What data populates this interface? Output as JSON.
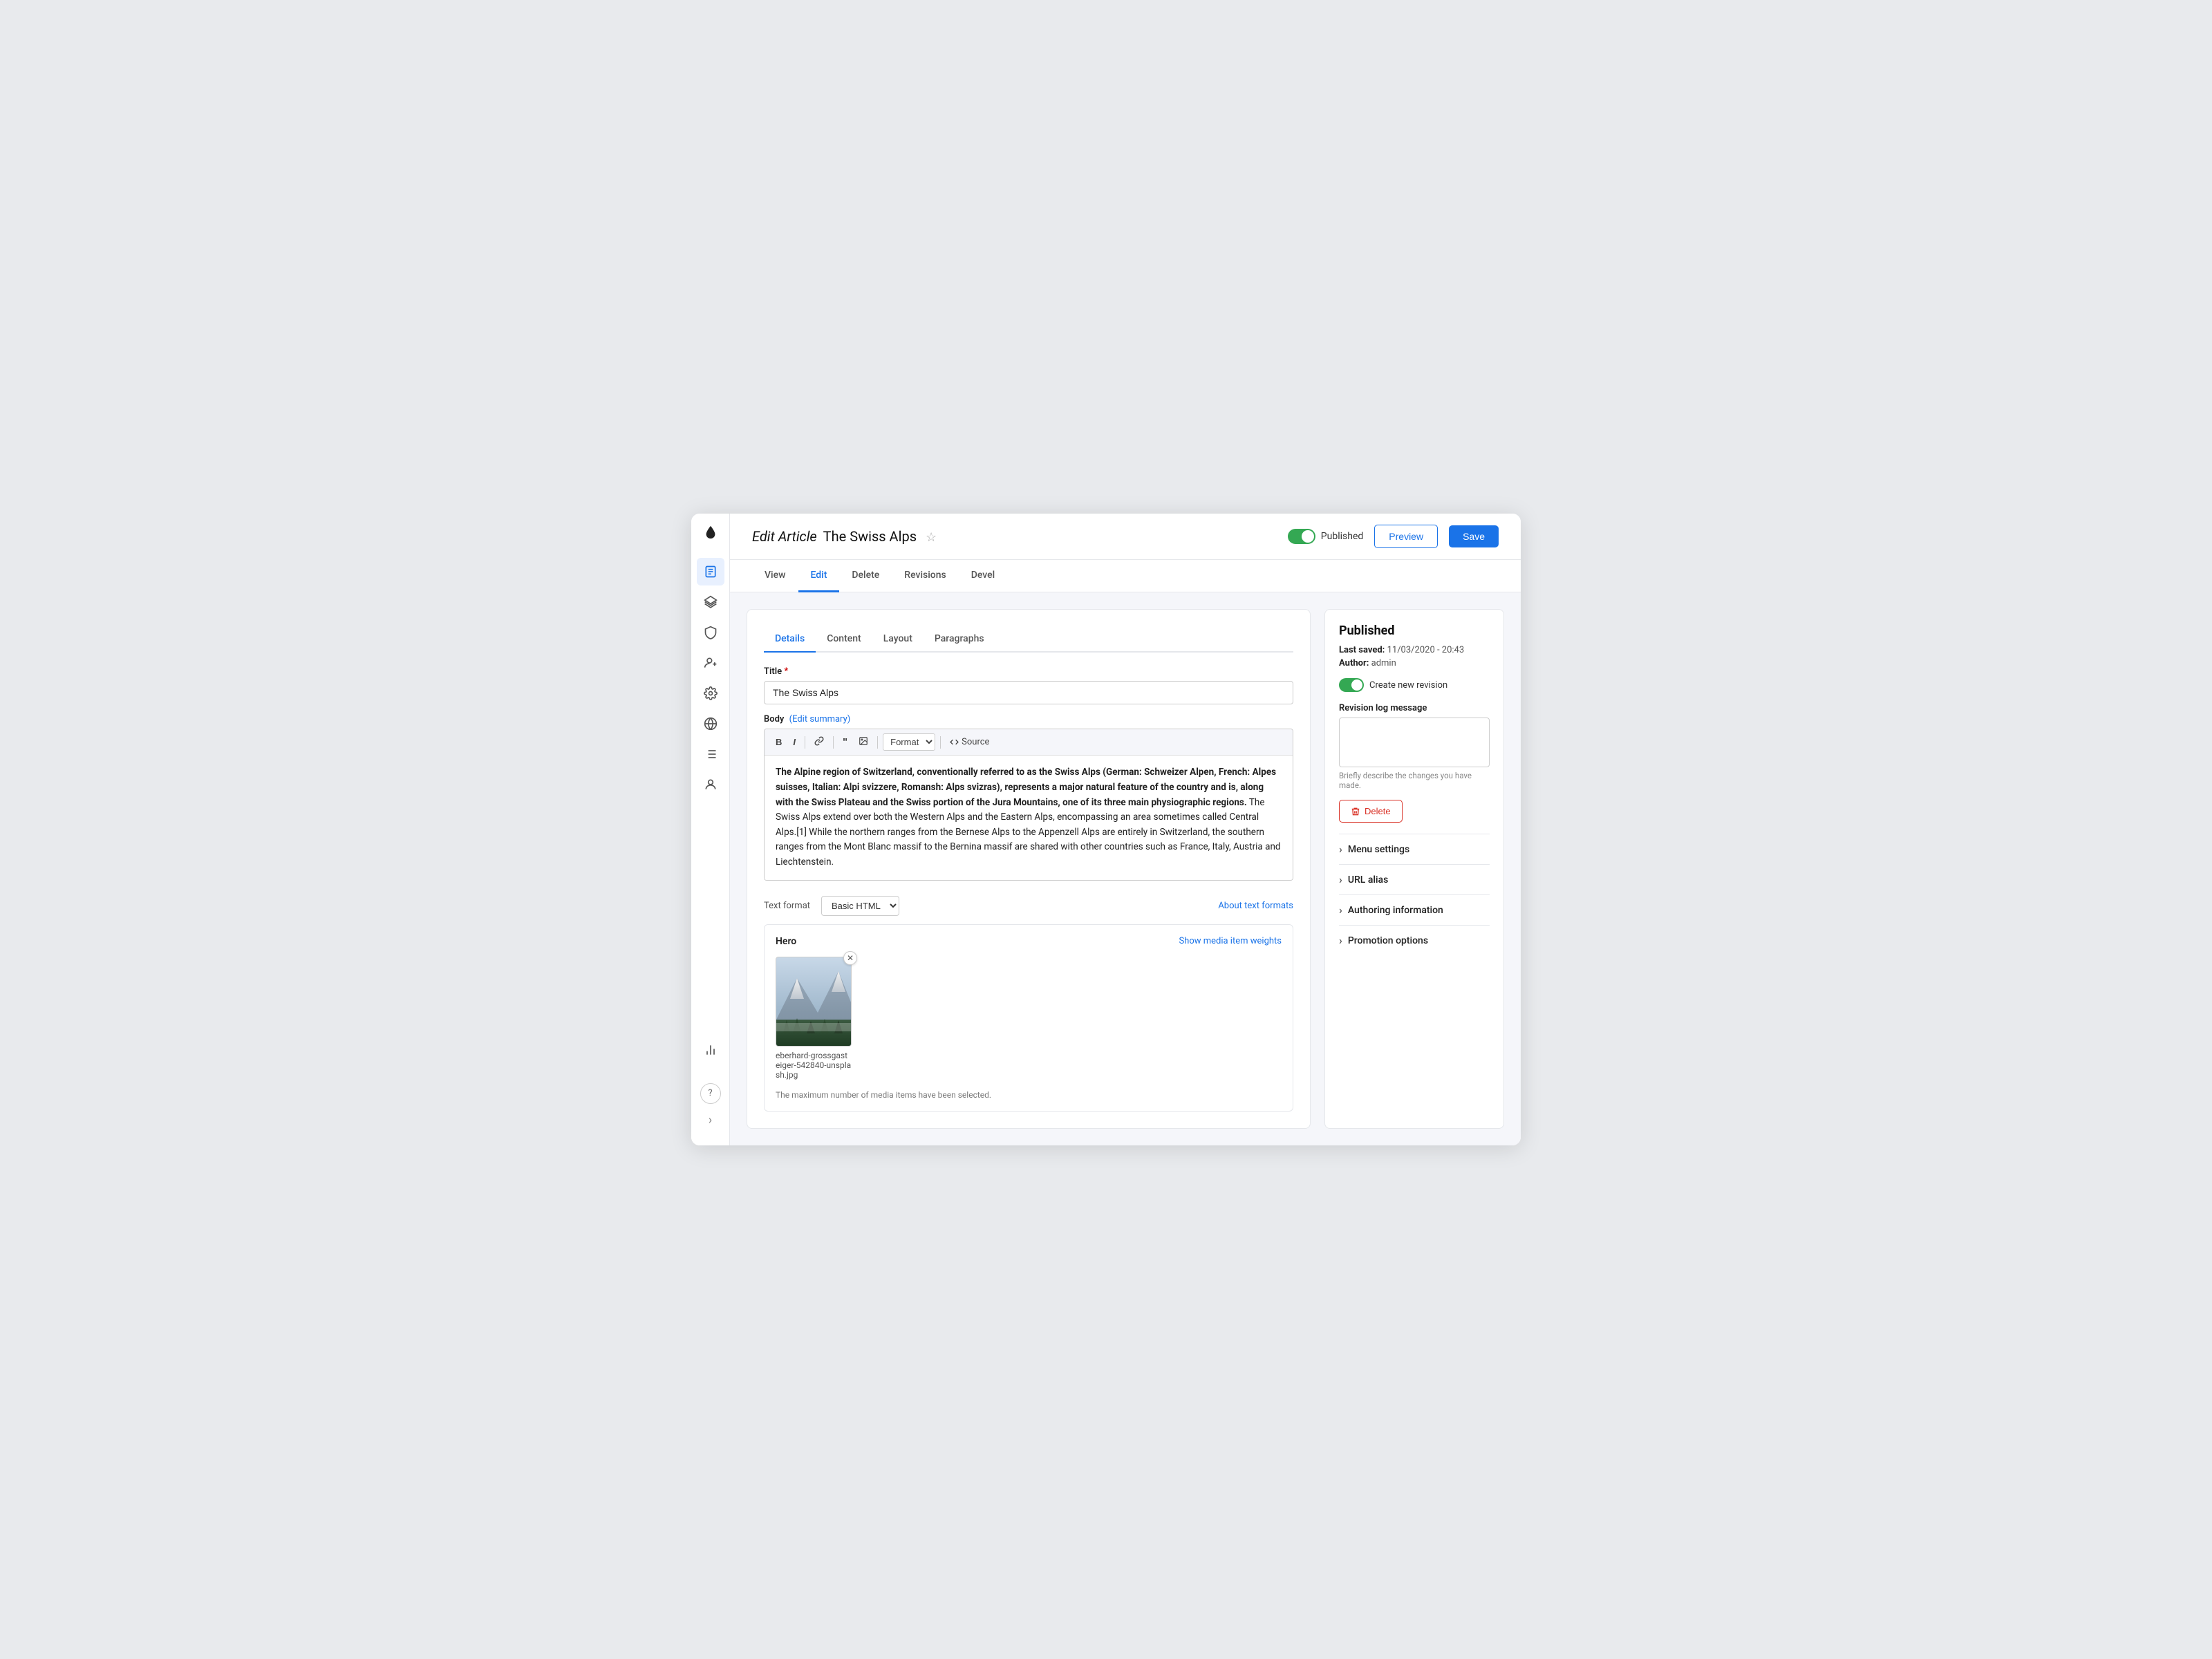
{
  "header": {
    "edit_label": "Edit Article",
    "article_title": "The Swiss Alps",
    "star_icon": "☆",
    "toggle_label": "Published",
    "btn_preview": "Preview",
    "btn_save": "Save"
  },
  "nav": {
    "tabs": [
      {
        "label": "View",
        "active": false
      },
      {
        "label": "Edit",
        "active": true
      },
      {
        "label": "Delete",
        "active": false
      },
      {
        "label": "Revisions",
        "active": false
      },
      {
        "label": "Devel",
        "active": false
      }
    ]
  },
  "sub_tabs": [
    {
      "label": "Details",
      "active": true
    },
    {
      "label": "Content",
      "active": false
    },
    {
      "label": "Layout",
      "active": false
    },
    {
      "label": "Paragraphs",
      "active": false
    }
  ],
  "form": {
    "title_label": "Title",
    "title_value": "The Swiss Alps",
    "body_label": "Body",
    "edit_summary_link": "(Edit summary)",
    "body_text_bold": "The Alpine region of Switzerland, conventionally referred to as the Swiss Alps (German: Schweizer Alpen, French: Alpes suisses, Italian: Alpi svizzere, Romansh: Alps svizras), represents a major natural feature of the country and is, along with the Swiss Plateau and the Swiss portion of the Jura Mountains, one of its three main physiographic regions.",
    "body_text_normal": " The Swiss Alps extend over both the Western Alps and the Eastern Alps, encompassing an area sometimes called Central Alps.[1] While the northern ranges from the Bernese Alps to the Appenzell Alps are entirely in Switzerland, the southern ranges from the Mont Blanc massif to the Bernina massif are shared with other countries such as France, Italy, Austria and Liechtenstein.",
    "text_format_label": "Text format",
    "text_format_value": "Basic HTML",
    "about_text_formats": "About text formats",
    "toolbar": {
      "bold": "B",
      "italic": "I",
      "format_label": "Format",
      "source_label": "Source"
    }
  },
  "hero": {
    "title": "Hero",
    "show_weights": "Show media item weights",
    "filename": "eberhard-grossgasteiger-542840-unsplash.jpg",
    "max_notice": "The maximum number of media items have been selected."
  },
  "sidebar": {
    "logo": "💧",
    "items": [
      {
        "icon": "article",
        "active": true
      },
      {
        "icon": "layers",
        "active": false
      },
      {
        "icon": "shield",
        "active": false
      },
      {
        "icon": "person-add",
        "active": false
      },
      {
        "icon": "settings",
        "active": false
      },
      {
        "icon": "globe",
        "active": false
      },
      {
        "icon": "list",
        "active": false
      },
      {
        "icon": "person",
        "active": false
      },
      {
        "icon": "chart",
        "active": false
      }
    ],
    "help_icon": "?",
    "expand_icon": "›"
  },
  "right_panel": {
    "title": "Published",
    "last_saved_label": "Last saved:",
    "last_saved_value": "11/03/2020 - 20:43",
    "author_label": "Author:",
    "author_value": "admin",
    "create_revision_label": "Create new revision",
    "revision_log_label": "Revision log message",
    "revision_placeholder": "",
    "revision_hint": "Briefly describe the changes you have made.",
    "btn_delete": "Delete",
    "accordion": [
      {
        "label": "Menu settings"
      },
      {
        "label": "URL alias"
      },
      {
        "label": "Authoring information"
      },
      {
        "label": "Promotion options"
      }
    ]
  }
}
